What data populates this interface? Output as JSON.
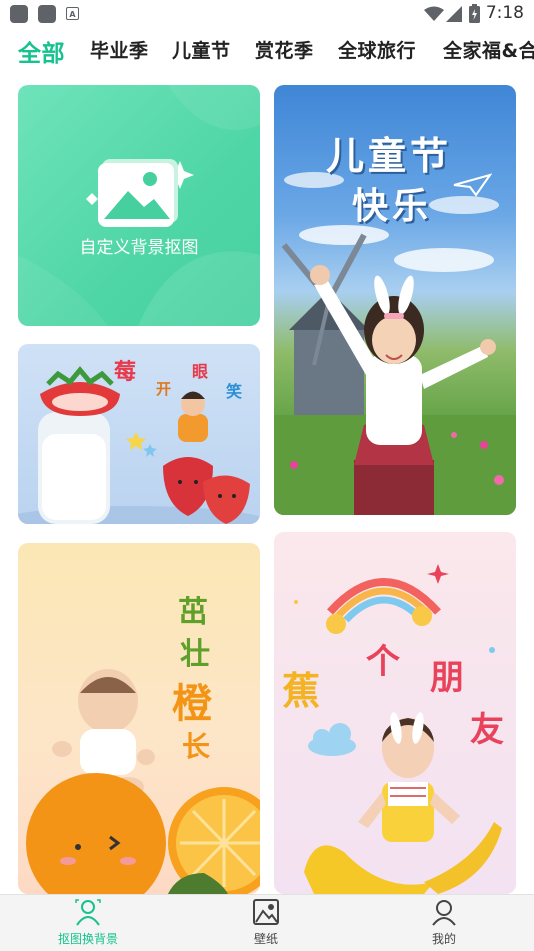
{
  "status_bar": {
    "time": "7:18",
    "icons": [
      "app-icon",
      "app-icon",
      "accessibility-a-icon",
      "wifi-icon",
      "signal-icon",
      "battery-icon"
    ]
  },
  "tabs": [
    {
      "label": "全部",
      "active": true
    },
    {
      "label": "毕业季",
      "active": false
    },
    {
      "label": "儿童节",
      "active": false
    },
    {
      "label": "赏花季",
      "active": false
    },
    {
      "label": "全球旅行",
      "active": false
    },
    {
      "label": "全家福&合",
      "active": false
    }
  ],
  "cards": {
    "custom": {
      "label": "自定义背景抠图",
      "icon": "image-placeholder-icon"
    },
    "childrens_day": {
      "title_line1": "儿童节",
      "title_line2": "快乐"
    },
    "strawberry": {
      "chars": [
        "莓",
        "开",
        "眼",
        "笑"
      ]
    },
    "orange": {
      "chars": [
        "茁",
        "壮",
        "橙",
        "长"
      ]
    },
    "banana": {
      "chars": [
        "蕉",
        "个",
        "朋",
        "友"
      ]
    }
  },
  "bottom_nav": [
    {
      "label": "抠图换背景",
      "icon": "person-cutout-icon",
      "active": true
    },
    {
      "label": "壁纸",
      "icon": "wallpaper-icon",
      "active": false
    },
    {
      "label": "我的",
      "icon": "profile-icon",
      "active": false
    }
  ],
  "colors": {
    "accent": "#16c28d",
    "inactive_text": "#444444",
    "custom_card": "#5ad9ad"
  }
}
